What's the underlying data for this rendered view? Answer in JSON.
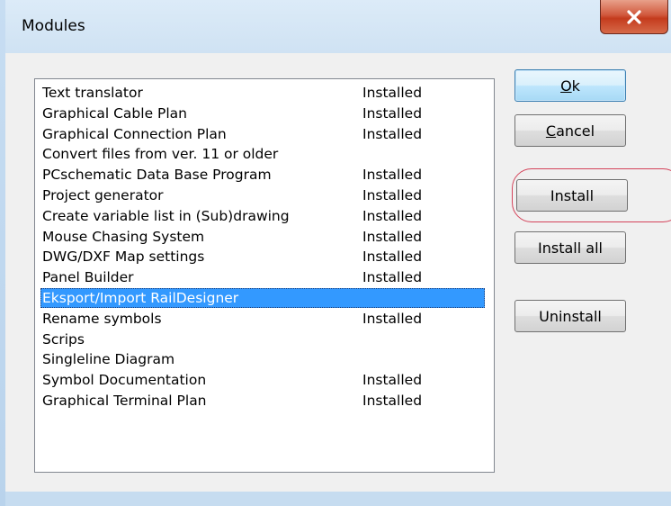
{
  "window": {
    "title": "Modules",
    "close_icon": "close-icon"
  },
  "modules": [
    {
      "name": "Text translator",
      "status": "Installed"
    },
    {
      "name": "Graphical Cable Plan",
      "status": "Installed"
    },
    {
      "name": "Graphical Connection Plan",
      "status": "Installed"
    },
    {
      "name": "Convert files from ver. 11 or older",
      "status": ""
    },
    {
      "name": "PCschematic Data Base Program",
      "status": "Installed"
    },
    {
      "name": "Project generator",
      "status": "Installed"
    },
    {
      "name": "Create variable list in (Sub)drawing",
      "status": "Installed"
    },
    {
      "name": "Mouse Chasing System",
      "status": "Installed"
    },
    {
      "name": "DWG/DXF Map settings",
      "status": "Installed"
    },
    {
      "name": "Panel Builder",
      "status": "Installed"
    },
    {
      "name": "Eksport/Import RailDesigner",
      "status": ""
    },
    {
      "name": "Rename symbols",
      "status": "Installed"
    },
    {
      "name": "Scrips",
      "status": ""
    },
    {
      "name": "Singleline Diagram",
      "status": ""
    },
    {
      "name": "Symbol Documentation",
      "status": "Installed"
    },
    {
      "name": "Graphical Terminal Plan",
      "status": "Installed"
    }
  ],
  "selected_index": 10,
  "buttons": {
    "ok_first": "O",
    "ok_rest": "k",
    "cancel_first": "C",
    "cancel_rest": "ancel",
    "install": "Install",
    "install_all": "Install all",
    "uninstall": "Uninstall"
  },
  "colors": {
    "selection": "#3399ff",
    "highlight_ring": "#d4435a",
    "close_button": "#c43b1d"
  }
}
